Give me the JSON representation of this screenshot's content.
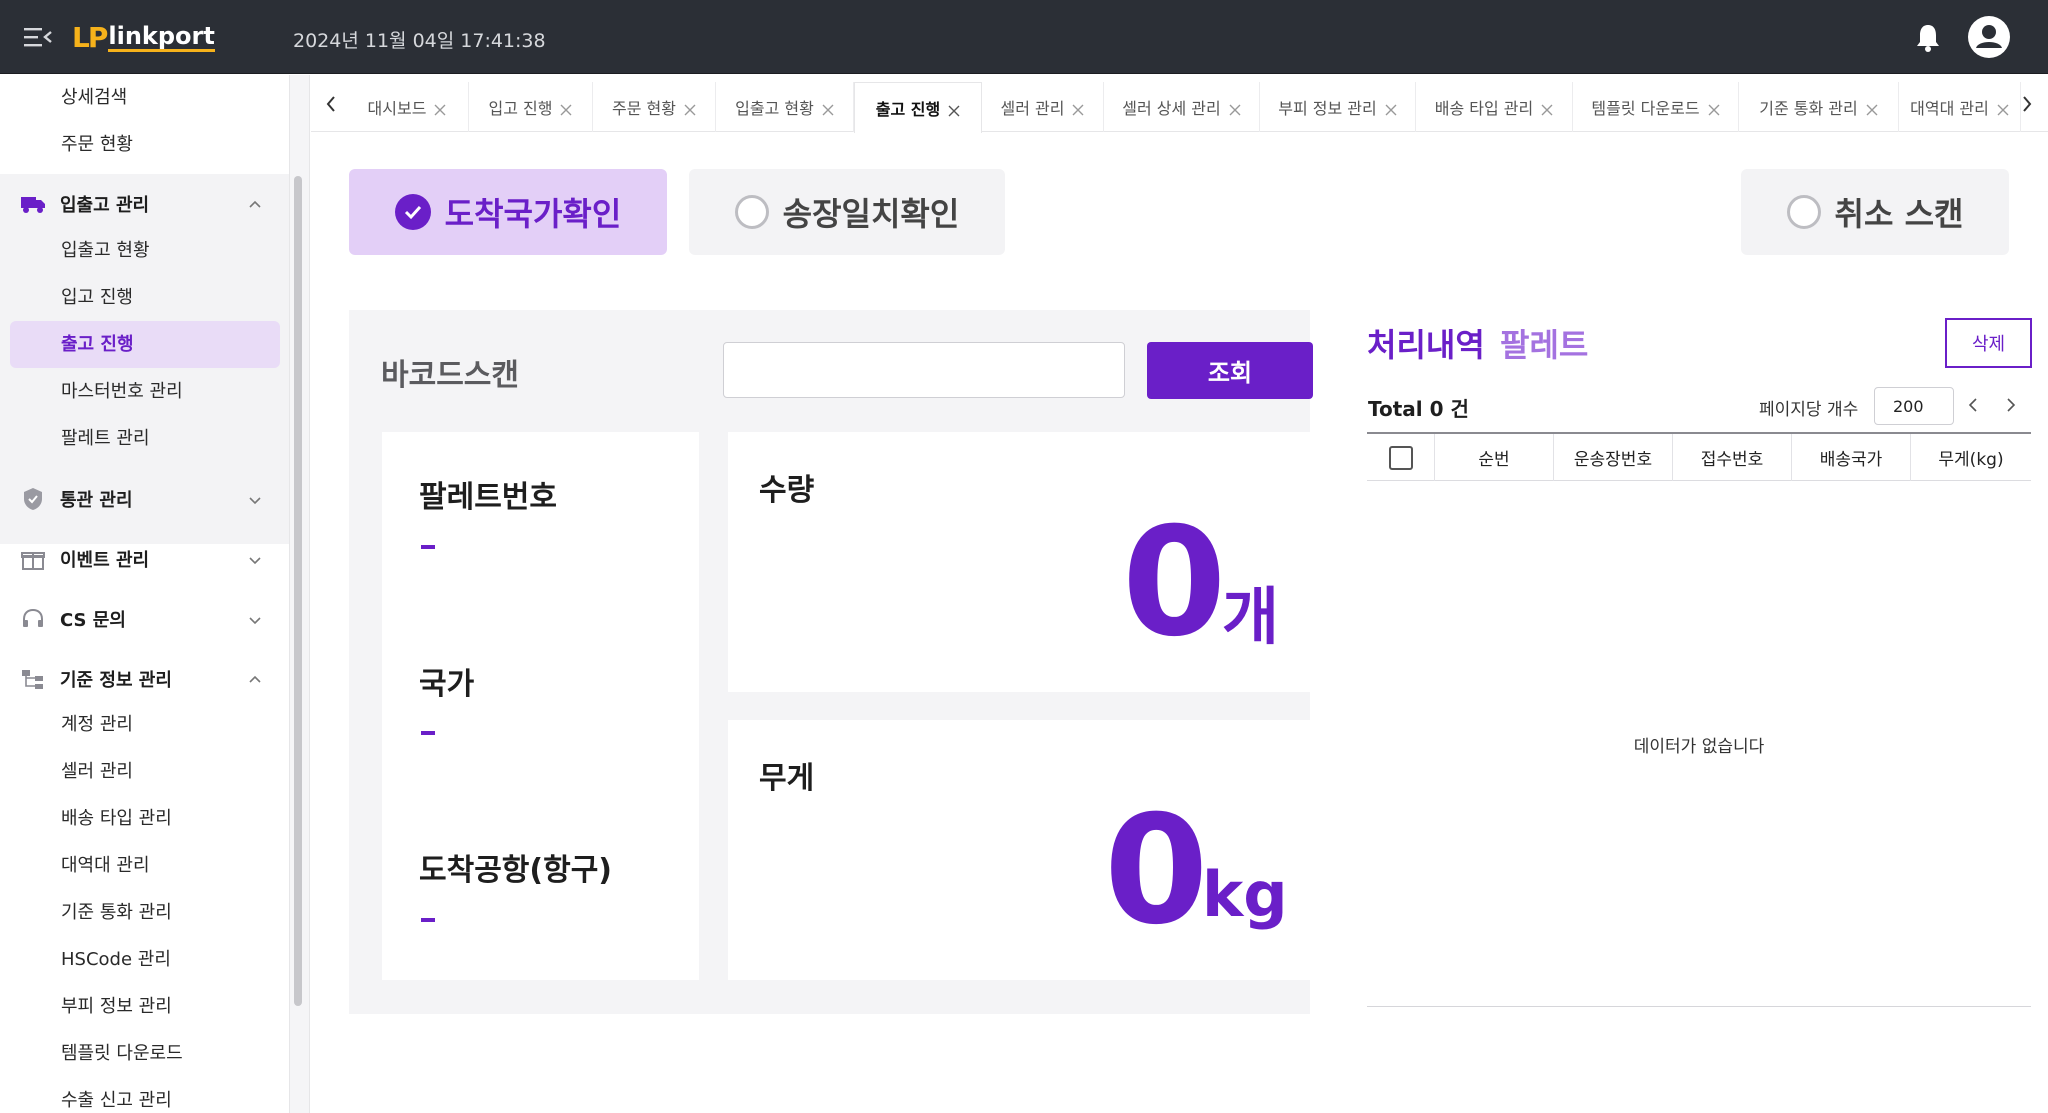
{
  "header": {
    "logo_mark": "LP",
    "logo_text": "linkport",
    "datetime": "2024년 11월 04일 17:41:38"
  },
  "sidebar": {
    "top_items": [
      "상세검색",
      "주문 현황"
    ],
    "groups": [
      {
        "label": "입출고 관리",
        "icon": "truck-icon",
        "expanded": true,
        "items": [
          "입출고 현황",
          "입고 진행",
          "출고 진행",
          "마스터번호 관리",
          "팔레트 관리"
        ]
      },
      {
        "label": "통관 관리",
        "icon": "shield-icon",
        "expanded": false,
        "items": []
      },
      {
        "label": "이벤트 관리",
        "icon": "gift-icon",
        "expanded": false,
        "items": []
      },
      {
        "label": "CS 문의",
        "icon": "headset-icon",
        "expanded": false,
        "items": []
      },
      {
        "label": "기준 정보 관리",
        "icon": "hierarchy-icon",
        "expanded": true,
        "items": [
          "계정 관리",
          "셀러 관리",
          "배송 타입 관리",
          "대역대 관리",
          "기준 통화 관리",
          "HSCode 관리",
          "부피 정보 관리",
          "템플릿 다운로드",
          "수출 신고 관리"
        ]
      }
    ],
    "active_item": "출고 진행"
  },
  "tabs": [
    "대시보드",
    "입고 진행",
    "주문 현황",
    "입출고 현황",
    "출고 진행",
    "셀러 관리",
    "셀러 상세 관리",
    "부피 정보 관리",
    "배송 타입 관리",
    "템플릿 다운로드",
    "기준 통화 관리",
    "대역대 관리"
  ],
  "active_tab": "출고 진행",
  "modes": {
    "arrival_check": "도착국가확인",
    "invoice_match": "송장일치확인",
    "cancel_scan": "취소 스캔"
  },
  "scan": {
    "title": "바코드스캔",
    "input_value": "",
    "button": "조회"
  },
  "info": {
    "pallet_label": "팔레트번호",
    "pallet_value": "-",
    "country_label": "국가",
    "country_value": "-",
    "airport_label": "도착공항(항구)",
    "airport_value": "-"
  },
  "quantity": {
    "label": "수량",
    "value": "0",
    "unit": "개"
  },
  "weight": {
    "label": "무게",
    "value": "0",
    "unit": "kg"
  },
  "history": {
    "title": "처리내역",
    "alt_tab": "팔레트",
    "delete_button": "삭제",
    "total": "Total 0 건",
    "page_size_label": "페이지당 개수",
    "page_size": "200",
    "columns": [
      "순번",
      "운송장번호",
      "접수번호",
      "배송국가",
      "무게(kg)"
    ],
    "empty_text": "데이터가 없습니다"
  },
  "colors": {
    "accent": "#6a1fc8",
    "accent_light": "#e3cff7",
    "header_bg": "#2b2f36"
  }
}
